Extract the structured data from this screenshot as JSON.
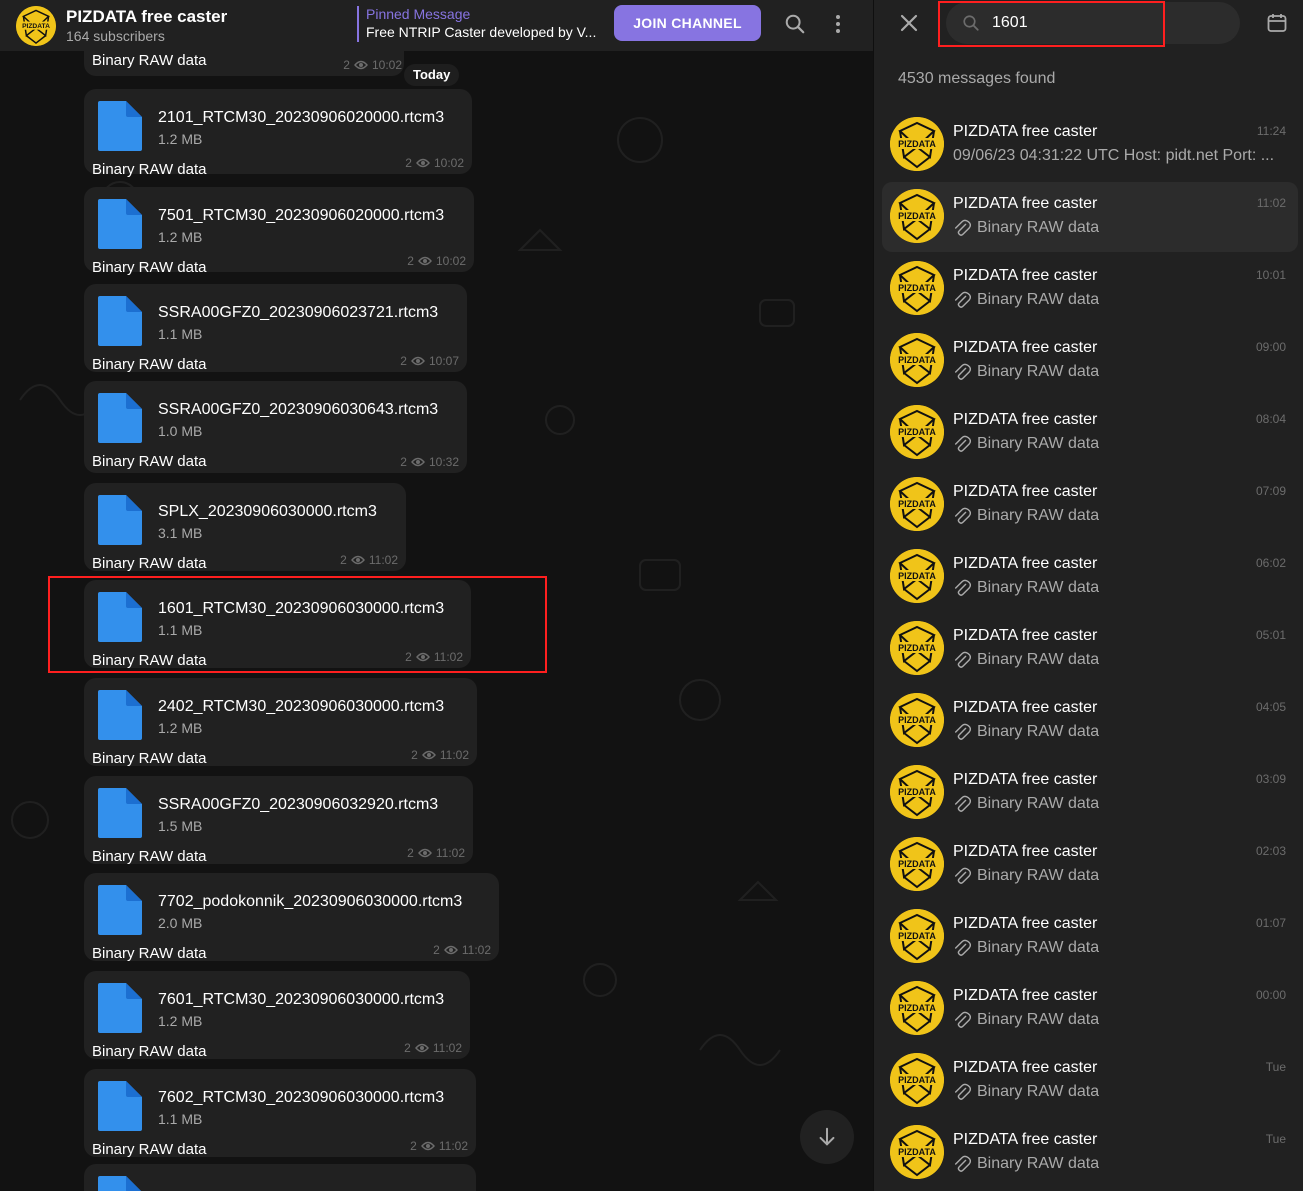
{
  "channel": {
    "name": "PIZDATA free caster",
    "subscribers": "164 subscribers",
    "avatar_text": "PIZDATA"
  },
  "pinned": {
    "title": "Pinned Message",
    "text": "Free NTRIP Caster developed by V..."
  },
  "header_buttons": {
    "join": "JOIN CHANNEL"
  },
  "date_badge": "Today",
  "first_message": {
    "caption": "Binary RAW data",
    "views": "2",
    "time": "10:02"
  },
  "messages": [
    {
      "file": "2101_RTCM30_20230906020000.rtcm3",
      "size": "1.2 MB",
      "caption": "Binary RAW data",
      "views": "2",
      "time": "10:02"
    },
    {
      "file": "7501_RTCM30_20230906020000.rtcm3",
      "size": "1.2 MB",
      "caption": "Binary RAW data",
      "views": "2",
      "time": "10:02"
    },
    {
      "file": "SSRA00GFZ0_20230906023721.rtcm3",
      "size": "1.1 MB",
      "caption": "Binary RAW data",
      "views": "2",
      "time": "10:07"
    },
    {
      "file": "SSRA00GFZ0_20230906030643.rtcm3",
      "size": "1.0 MB",
      "caption": "Binary RAW data",
      "views": "2",
      "time": "10:32"
    },
    {
      "file": "SPLX_20230906030000.rtcm3",
      "size": "3.1 MB",
      "caption": "Binary RAW data",
      "views": "2",
      "time": "11:02"
    },
    {
      "file": "1601_RTCM30_20230906030000.rtcm3",
      "size": "1.1 MB",
      "caption": "Binary RAW data",
      "views": "2",
      "time": "11:02"
    },
    {
      "file": "2402_RTCM30_20230906030000.rtcm3",
      "size": "1.2 MB",
      "caption": "Binary RAW data",
      "views": "2",
      "time": "11:02"
    },
    {
      "file": "SSRA00GFZ0_20230906032920.rtcm3",
      "size": "1.5 MB",
      "caption": "Binary RAW data",
      "views": "2",
      "time": "11:02"
    },
    {
      "file": "7702_podokonnik_20230906030000.rtcm3",
      "size": "2.0 MB",
      "caption": "Binary RAW data",
      "views": "2",
      "time": "11:02"
    },
    {
      "file": "7601_RTCM30_20230906030000.rtcm3",
      "size": "1.2 MB",
      "caption": "Binary RAW data",
      "views": "2",
      "time": "11:02"
    },
    {
      "file": "7602_RTCM30_20230906030000.rtcm3",
      "size": "1.1 MB",
      "caption": "Binary RAW data",
      "views": "2",
      "time": "11:02"
    }
  ],
  "search": {
    "query": "1601",
    "count": "4530 messages found",
    "results": [
      {
        "name": "PIZDATA free caster",
        "time": "11:24",
        "text": "09/06/23 04:31:22 UTC Host: pidt.net Port: ...",
        "attachment": false
      },
      {
        "name": "PIZDATA free caster",
        "time": "11:02",
        "text": "Binary RAW data",
        "attachment": true
      },
      {
        "name": "PIZDATA free caster",
        "time": "10:01",
        "text": "Binary RAW data",
        "attachment": true
      },
      {
        "name": "PIZDATA free caster",
        "time": "09:00",
        "text": "Binary RAW data",
        "attachment": true
      },
      {
        "name": "PIZDATA free caster",
        "time": "08:04",
        "text": "Binary RAW data",
        "attachment": true
      },
      {
        "name": "PIZDATA free caster",
        "time": "07:09",
        "text": "Binary RAW data",
        "attachment": true
      },
      {
        "name": "PIZDATA free caster",
        "time": "06:02",
        "text": "Binary RAW data",
        "attachment": true
      },
      {
        "name": "PIZDATA free caster",
        "time": "05:01",
        "text": "Binary RAW data",
        "attachment": true
      },
      {
        "name": "PIZDATA free caster",
        "time": "04:05",
        "text": "Binary RAW data",
        "attachment": true
      },
      {
        "name": "PIZDATA free caster",
        "time": "03:09",
        "text": "Binary RAW data",
        "attachment": true
      },
      {
        "name": "PIZDATA free caster",
        "time": "02:03",
        "text": "Binary RAW data",
        "attachment": true
      },
      {
        "name": "PIZDATA free caster",
        "time": "01:07",
        "text": "Binary RAW data",
        "attachment": true
      },
      {
        "name": "PIZDATA free caster",
        "time": "00:00",
        "text": "Binary RAW data",
        "attachment": true
      },
      {
        "name": "PIZDATA free caster",
        "time": "Tue",
        "text": "Binary RAW data",
        "attachment": true
      },
      {
        "name": "PIZDATA free caster",
        "time": "Tue",
        "text": "Binary RAW data",
        "attachment": true
      }
    ]
  },
  "colors": {
    "accent": "#8774e1",
    "file_icon": "#3390ec",
    "avatar_bg": "#f0c419",
    "highlight": "#ff1f1f"
  },
  "icons": {
    "search": "search-icon",
    "more": "more-vertical-icon",
    "close": "close-icon",
    "calendar": "calendar-icon",
    "scroll_down": "arrow-down-icon",
    "file": "file-icon",
    "views": "eye-icon",
    "attachment": "paperclip-icon"
  }
}
